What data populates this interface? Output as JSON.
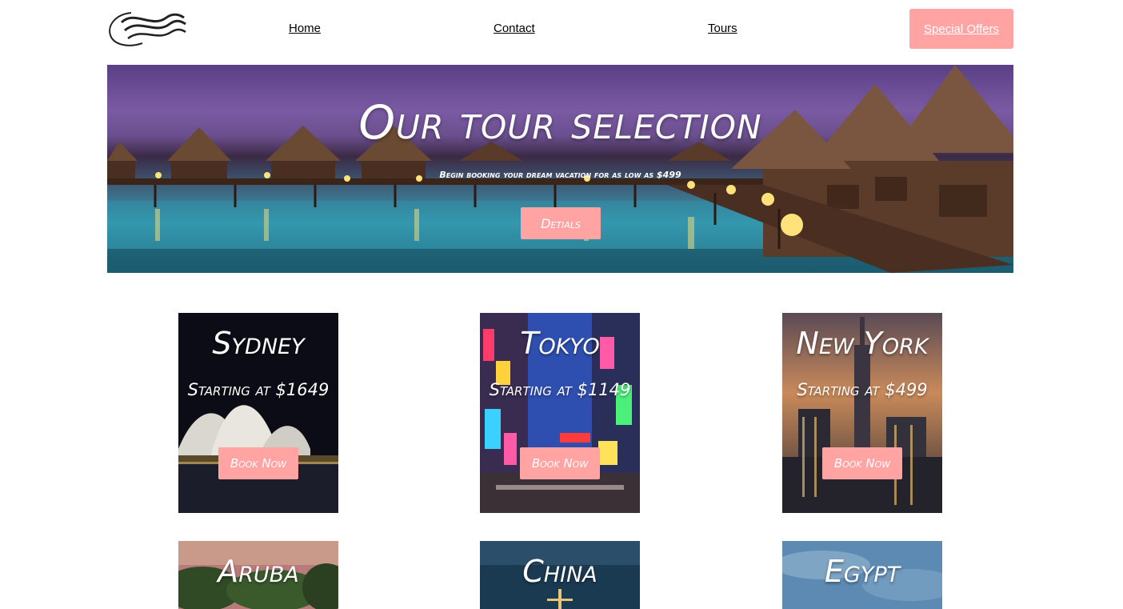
{
  "header": {
    "logo_icon": "wave-logo-icon",
    "nav": {
      "home": "Home",
      "contact": "Contact",
      "tours": "Tours"
    },
    "special_offers": "Special Offers"
  },
  "hero": {
    "title": "Our tour selection",
    "subtitle": "Begin booking your dream vacation for as low as $499",
    "button": "Detials"
  },
  "tours": [
    {
      "city": "Sydney",
      "price": "Starting at $1649",
      "button": "Book Now"
    },
    {
      "city": "Tokyo",
      "price": "Starting at $1149",
      "button": "Book Now"
    },
    {
      "city": "New York",
      "price": "Starting at $499",
      "button": "Book Now"
    },
    {
      "city": "Aruba"
    },
    {
      "city": "China"
    },
    {
      "city": "Egypt"
    }
  ],
  "colors": {
    "accent": "#ffa3a3",
    "text": "#000000",
    "background": "#ffffff"
  }
}
